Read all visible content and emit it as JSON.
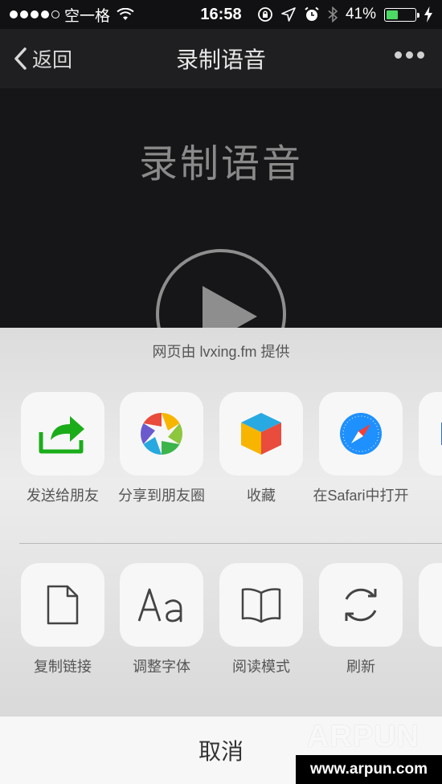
{
  "status_bar": {
    "carrier": "空一格",
    "time": "16:58",
    "battery": "41%",
    "battery_level": 0.41,
    "battery_color": "#4cd964"
  },
  "nav": {
    "back_label": "返回",
    "title": "录制语音",
    "more_icon": "ellipsis-icon"
  },
  "content": {
    "title": "录制语音",
    "play_icon": "play-icon"
  },
  "share_sheet": {
    "caption": "网页由 lvxing.fm 提供",
    "primary_actions": [
      {
        "label": "发送给朋友",
        "icon": "send-to-friend-icon"
      },
      {
        "label": "分享到朋友圈",
        "icon": "moments-icon"
      },
      {
        "label": "收藏",
        "icon": "favorites-cube-icon"
      },
      {
        "label": "在Safari中打开",
        "icon": "safari-compass-icon"
      }
    ],
    "secondary_actions": [
      {
        "label": "复制链接",
        "icon": "document-icon"
      },
      {
        "label": "调整字体",
        "icon": "font-aa-icon"
      },
      {
        "label": "阅读模式",
        "icon": "book-icon"
      },
      {
        "label": "刷新",
        "icon": "refresh-icon"
      }
    ],
    "cancel_label": "取消"
  },
  "watermark": {
    "brand": "ARPUN",
    "url": "www.arpun.com"
  }
}
